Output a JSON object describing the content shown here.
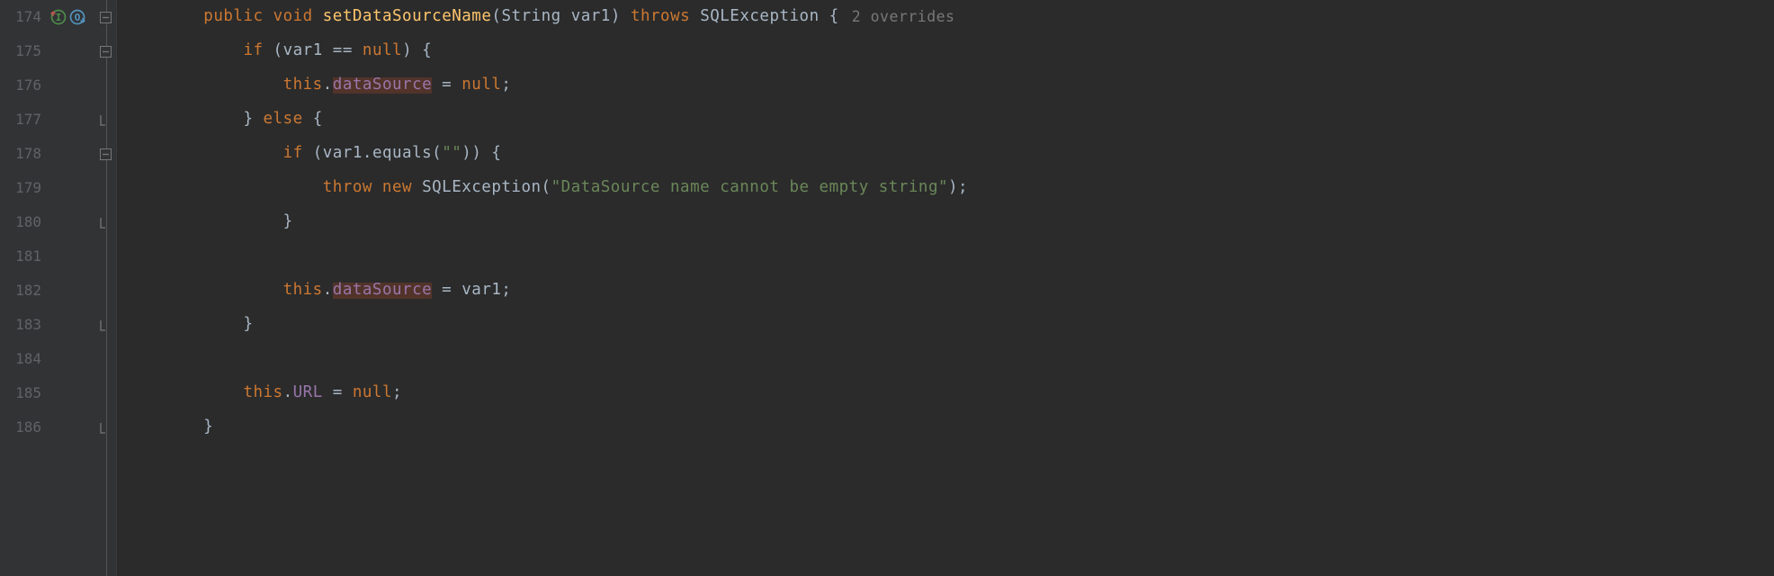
{
  "gutter": {
    "start": 174,
    "end": 186
  },
  "hint": "2 overrides",
  "code": {
    "l174": {
      "prefix": "        ",
      "public": "public",
      "void": "void",
      "method": "setDataSourceName",
      "paren_open": "(",
      "param_type": "String ",
      "param_name": "var1",
      "paren_close": ") ",
      "throws": "throws",
      "exc": "SQLException ",
      "brace": "{"
    },
    "l175": {
      "prefix": "            ",
      "if": "if",
      "cond_open": " (",
      "var": "var1",
      "eq": " == ",
      "null": "null",
      "cond_close": ") {"
    },
    "l176": {
      "prefix": "                ",
      "this": "this",
      "dot": ".",
      "field": "dataSource",
      "assign": " = ",
      "null": "null",
      "semi": ";"
    },
    "l177": {
      "prefix": "            ",
      "close": "} ",
      "else": "else",
      "open": " {"
    },
    "l178": {
      "prefix": "                ",
      "if": "if",
      "cond_open": " (",
      "var": "var1",
      "dot": ".",
      "equals": "equals",
      "args_open": "(",
      "str": "\"\"",
      "args_close": ")) {"
    },
    "l179": {
      "prefix": "                    ",
      "throw": "throw new",
      "sp": " ",
      "exc": "SQLException",
      "args_open": "(",
      "str": "\"DataSource name cannot be empty string\"",
      "args_close": ");"
    },
    "l180": {
      "prefix": "                ",
      "close": "}"
    },
    "l181": {
      "prefix": ""
    },
    "l182": {
      "prefix": "                ",
      "this": "this",
      "dot": ".",
      "field": "dataSource",
      "assign": " = var1;"
    },
    "l183": {
      "prefix": "            ",
      "close": "}"
    },
    "l184": {
      "prefix": ""
    },
    "l185": {
      "prefix": "            ",
      "this": "this",
      "dot": ".",
      "field": "URL",
      "assign": " = ",
      "null": "null",
      "semi": ";"
    },
    "l186": {
      "prefix": "        ",
      "close": "}"
    }
  }
}
